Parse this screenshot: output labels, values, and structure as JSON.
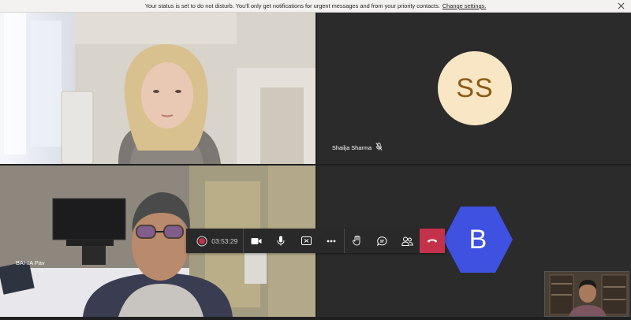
{
  "banner": {
    "message": "Your status is set to do not disturb. You'll only get notifications for urgent messages and from your priority contacts.",
    "link": "Change settings."
  },
  "participants": {
    "top_right": {
      "name": "Shailja Sharma",
      "initials": "SS"
    },
    "bottom_left": {
      "name": "BAHIA Pav"
    },
    "bottom_right": {
      "initials": "B"
    }
  },
  "controls": {
    "timer": "03:53:29",
    "icons": [
      "record-icon",
      "camera-icon",
      "microphone-icon",
      "share-screen-icon",
      "more-icon",
      "raise-hand-icon",
      "chat-icon",
      "people-icon",
      "hang-up-icon"
    ]
  },
  "colors": {
    "hangup": "#c4314b",
    "avatar_ss_bg": "#f8e6c4",
    "avatar_ss_text": "#8a5a16",
    "avatar_b_bg": "#3f51e0"
  }
}
